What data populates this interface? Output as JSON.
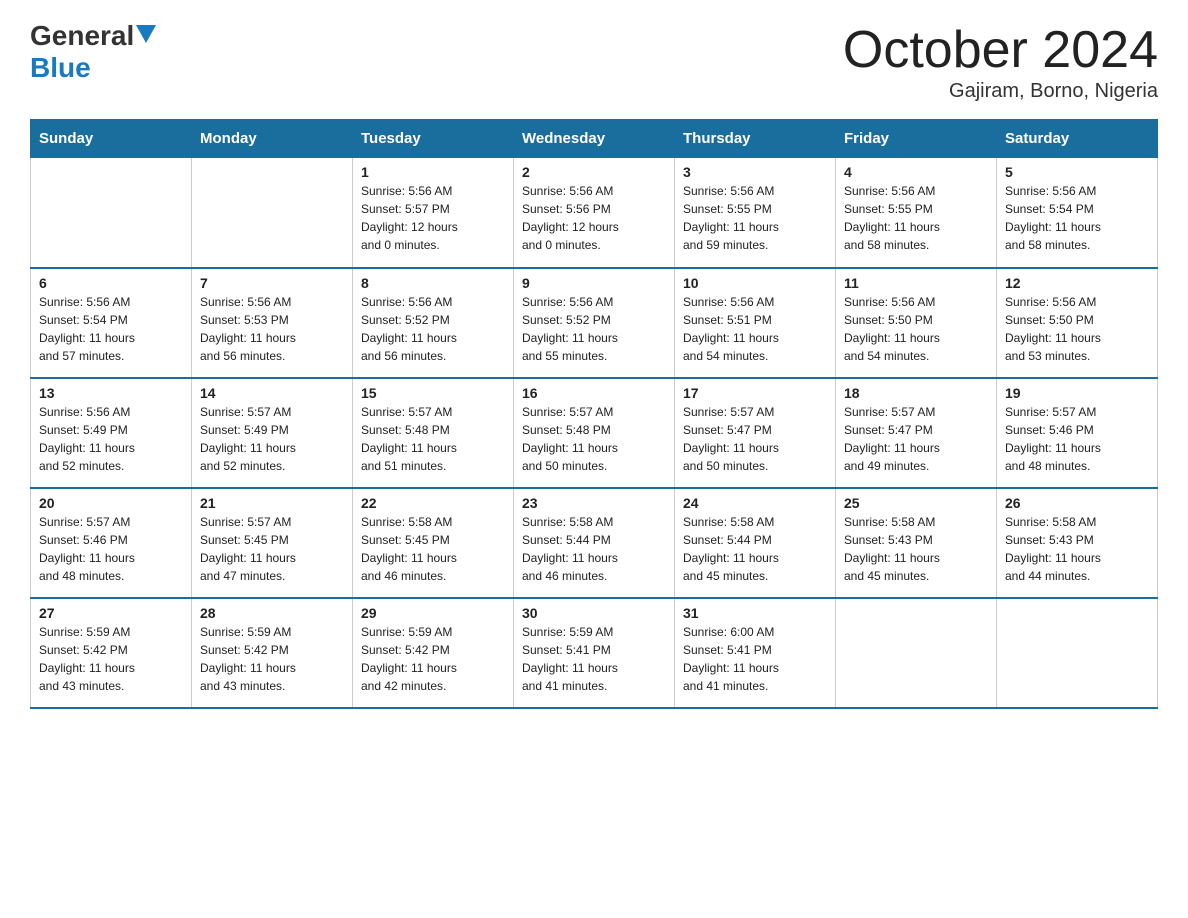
{
  "header": {
    "logo_general": "General",
    "logo_blue": "Blue",
    "month_title": "October 2024",
    "location": "Gajiram, Borno, Nigeria"
  },
  "weekdays": [
    "Sunday",
    "Monday",
    "Tuesday",
    "Wednesday",
    "Thursday",
    "Friday",
    "Saturday"
  ],
  "weeks": [
    [
      {
        "day": "",
        "info": ""
      },
      {
        "day": "",
        "info": ""
      },
      {
        "day": "1",
        "info": "Sunrise: 5:56 AM\nSunset: 5:57 PM\nDaylight: 12 hours\nand 0 minutes."
      },
      {
        "day": "2",
        "info": "Sunrise: 5:56 AM\nSunset: 5:56 PM\nDaylight: 12 hours\nand 0 minutes."
      },
      {
        "day": "3",
        "info": "Sunrise: 5:56 AM\nSunset: 5:55 PM\nDaylight: 11 hours\nand 59 minutes."
      },
      {
        "day": "4",
        "info": "Sunrise: 5:56 AM\nSunset: 5:55 PM\nDaylight: 11 hours\nand 58 minutes."
      },
      {
        "day": "5",
        "info": "Sunrise: 5:56 AM\nSunset: 5:54 PM\nDaylight: 11 hours\nand 58 minutes."
      }
    ],
    [
      {
        "day": "6",
        "info": "Sunrise: 5:56 AM\nSunset: 5:54 PM\nDaylight: 11 hours\nand 57 minutes."
      },
      {
        "day": "7",
        "info": "Sunrise: 5:56 AM\nSunset: 5:53 PM\nDaylight: 11 hours\nand 56 minutes."
      },
      {
        "day": "8",
        "info": "Sunrise: 5:56 AM\nSunset: 5:52 PM\nDaylight: 11 hours\nand 56 minutes."
      },
      {
        "day": "9",
        "info": "Sunrise: 5:56 AM\nSunset: 5:52 PM\nDaylight: 11 hours\nand 55 minutes."
      },
      {
        "day": "10",
        "info": "Sunrise: 5:56 AM\nSunset: 5:51 PM\nDaylight: 11 hours\nand 54 minutes."
      },
      {
        "day": "11",
        "info": "Sunrise: 5:56 AM\nSunset: 5:50 PM\nDaylight: 11 hours\nand 54 minutes."
      },
      {
        "day": "12",
        "info": "Sunrise: 5:56 AM\nSunset: 5:50 PM\nDaylight: 11 hours\nand 53 minutes."
      }
    ],
    [
      {
        "day": "13",
        "info": "Sunrise: 5:56 AM\nSunset: 5:49 PM\nDaylight: 11 hours\nand 52 minutes."
      },
      {
        "day": "14",
        "info": "Sunrise: 5:57 AM\nSunset: 5:49 PM\nDaylight: 11 hours\nand 52 minutes."
      },
      {
        "day": "15",
        "info": "Sunrise: 5:57 AM\nSunset: 5:48 PM\nDaylight: 11 hours\nand 51 minutes."
      },
      {
        "day": "16",
        "info": "Sunrise: 5:57 AM\nSunset: 5:48 PM\nDaylight: 11 hours\nand 50 minutes."
      },
      {
        "day": "17",
        "info": "Sunrise: 5:57 AM\nSunset: 5:47 PM\nDaylight: 11 hours\nand 50 minutes."
      },
      {
        "day": "18",
        "info": "Sunrise: 5:57 AM\nSunset: 5:47 PM\nDaylight: 11 hours\nand 49 minutes."
      },
      {
        "day": "19",
        "info": "Sunrise: 5:57 AM\nSunset: 5:46 PM\nDaylight: 11 hours\nand 48 minutes."
      }
    ],
    [
      {
        "day": "20",
        "info": "Sunrise: 5:57 AM\nSunset: 5:46 PM\nDaylight: 11 hours\nand 48 minutes."
      },
      {
        "day": "21",
        "info": "Sunrise: 5:57 AM\nSunset: 5:45 PM\nDaylight: 11 hours\nand 47 minutes."
      },
      {
        "day": "22",
        "info": "Sunrise: 5:58 AM\nSunset: 5:45 PM\nDaylight: 11 hours\nand 46 minutes."
      },
      {
        "day": "23",
        "info": "Sunrise: 5:58 AM\nSunset: 5:44 PM\nDaylight: 11 hours\nand 46 minutes."
      },
      {
        "day": "24",
        "info": "Sunrise: 5:58 AM\nSunset: 5:44 PM\nDaylight: 11 hours\nand 45 minutes."
      },
      {
        "day": "25",
        "info": "Sunrise: 5:58 AM\nSunset: 5:43 PM\nDaylight: 11 hours\nand 45 minutes."
      },
      {
        "day": "26",
        "info": "Sunrise: 5:58 AM\nSunset: 5:43 PM\nDaylight: 11 hours\nand 44 minutes."
      }
    ],
    [
      {
        "day": "27",
        "info": "Sunrise: 5:59 AM\nSunset: 5:42 PM\nDaylight: 11 hours\nand 43 minutes."
      },
      {
        "day": "28",
        "info": "Sunrise: 5:59 AM\nSunset: 5:42 PM\nDaylight: 11 hours\nand 43 minutes."
      },
      {
        "day": "29",
        "info": "Sunrise: 5:59 AM\nSunset: 5:42 PM\nDaylight: 11 hours\nand 42 minutes."
      },
      {
        "day": "30",
        "info": "Sunrise: 5:59 AM\nSunset: 5:41 PM\nDaylight: 11 hours\nand 41 minutes."
      },
      {
        "day": "31",
        "info": "Sunrise: 6:00 AM\nSunset: 5:41 PM\nDaylight: 11 hours\nand 41 minutes."
      },
      {
        "day": "",
        "info": ""
      },
      {
        "day": "",
        "info": ""
      }
    ]
  ]
}
